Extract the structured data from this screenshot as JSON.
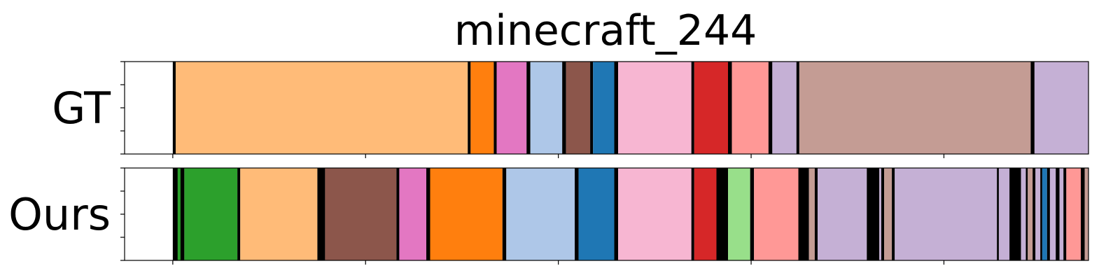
{
  "chart_data": {
    "type": "segmentation_timeline",
    "title": "minecraft_244",
    "x_range": [
      0,
      1
    ],
    "rows": [
      {
        "label": "GT",
        "segments": [
          {
            "start": 0.0,
            "end": 0.05,
            "color": "#ffffff"
          },
          {
            "start": 0.05,
            "end": 0.053,
            "color": "#000000"
          },
          {
            "start": 0.053,
            "end": 0.356,
            "color": "#ffbb78"
          },
          {
            "start": 0.356,
            "end": 0.359,
            "color": "#000000"
          },
          {
            "start": 0.359,
            "end": 0.383,
            "color": "#ff7f0e"
          },
          {
            "start": 0.383,
            "end": 0.386,
            "color": "#000000"
          },
          {
            "start": 0.386,
            "end": 0.417,
            "color": "#e377c2"
          },
          {
            "start": 0.417,
            "end": 0.421,
            "color": "#000000"
          },
          {
            "start": 0.421,
            "end": 0.454,
            "color": "#aec7e8"
          },
          {
            "start": 0.454,
            "end": 0.458,
            "color": "#000000"
          },
          {
            "start": 0.458,
            "end": 0.483,
            "color": "#8c564b"
          },
          {
            "start": 0.483,
            "end": 0.486,
            "color": "#000000"
          },
          {
            "start": 0.486,
            "end": 0.508,
            "color": "#1f77b4"
          },
          {
            "start": 0.508,
            "end": 0.512,
            "color": "#000000"
          },
          {
            "start": 0.512,
            "end": 0.588,
            "color": "#f7b6d2"
          },
          {
            "start": 0.588,
            "end": 0.591,
            "color": "#000000"
          },
          {
            "start": 0.591,
            "end": 0.626,
            "color": "#d62728"
          },
          {
            "start": 0.626,
            "end": 0.63,
            "color": "#000000"
          },
          {
            "start": 0.63,
            "end": 0.668,
            "color": "#ff9896"
          },
          {
            "start": 0.668,
            "end": 0.672,
            "color": "#000000"
          },
          {
            "start": 0.672,
            "end": 0.697,
            "color": "#c5b0d5"
          },
          {
            "start": 0.697,
            "end": 0.7,
            "color": "#000000"
          },
          {
            "start": 0.7,
            "end": 0.94,
            "color": "#c49c94"
          },
          {
            "start": 0.94,
            "end": 0.944,
            "color": "#000000"
          },
          {
            "start": 0.944,
            "end": 1.05,
            "color": "#c5b0d5"
          },
          {
            "start": 1.05,
            "end": 1.053,
            "color": "#000000"
          },
          {
            "start": 1.053,
            "end": 1.1,
            "color": "#ffffff"
          }
        ]
      },
      {
        "label": "Ours",
        "segments": [
          {
            "start": 0.0,
            "end": 0.05,
            "color": "#ffffff"
          },
          {
            "start": 0.05,
            "end": 0.062,
            "color": "#000000"
          },
          {
            "start": 0.055,
            "end": 0.058,
            "color": "#2ca02c"
          },
          {
            "start": 0.062,
            "end": 0.117,
            "color": "#2ca02c"
          },
          {
            "start": 0.117,
            "end": 0.12,
            "color": "#000000"
          },
          {
            "start": 0.12,
            "end": 0.2,
            "color": "#ffbb78"
          },
          {
            "start": 0.2,
            "end": 0.208,
            "color": "#000000"
          },
          {
            "start": 0.208,
            "end": 0.282,
            "color": "#8c564b"
          },
          {
            "start": 0.282,
            "end": 0.285,
            "color": "#000000"
          },
          {
            "start": 0.285,
            "end": 0.313,
            "color": "#e377c2"
          },
          {
            "start": 0.313,
            "end": 0.317,
            "color": "#000000"
          },
          {
            "start": 0.317,
            "end": 0.392,
            "color": "#ff7f0e"
          },
          {
            "start": 0.392,
            "end": 0.396,
            "color": "#000000"
          },
          {
            "start": 0.396,
            "end": 0.467,
            "color": "#aec7e8"
          },
          {
            "start": 0.467,
            "end": 0.471,
            "color": "#000000"
          },
          {
            "start": 0.471,
            "end": 0.508,
            "color": "#1f77b4"
          },
          {
            "start": 0.508,
            "end": 0.512,
            "color": "#000000"
          },
          {
            "start": 0.512,
            "end": 0.588,
            "color": "#f7b6d2"
          },
          {
            "start": 0.588,
            "end": 0.591,
            "color": "#000000"
          },
          {
            "start": 0.591,
            "end": 0.614,
            "color": "#d62728"
          },
          {
            "start": 0.614,
            "end": 0.626,
            "color": "#000000"
          },
          {
            "start": 0.626,
            "end": 0.649,
            "color": "#98df8a"
          },
          {
            "start": 0.649,
            "end": 0.653,
            "color": "#000000"
          },
          {
            "start": 0.653,
            "end": 0.699,
            "color": "#ff9896"
          },
          {
            "start": 0.699,
            "end": 0.71,
            "color": "#000000"
          },
          {
            "start": 0.71,
            "end": 0.716,
            "color": "#c49c94"
          },
          {
            "start": 0.716,
            "end": 0.719,
            "color": "#000000"
          },
          {
            "start": 0.719,
            "end": 0.77,
            "color": "#c5b0d5"
          },
          {
            "start": 0.77,
            "end": 0.783,
            "color": "#000000"
          },
          {
            "start": 0.783,
            "end": 0.785,
            "color": "#c5b0d5"
          },
          {
            "start": 0.785,
            "end": 0.788,
            "color": "#000000"
          },
          {
            "start": 0.788,
            "end": 0.796,
            "color": "#c49c94"
          },
          {
            "start": 0.796,
            "end": 0.799,
            "color": "#000000"
          },
          {
            "start": 0.799,
            "end": 0.905,
            "color": "#c5b0d5"
          },
          {
            "start": 0.905,
            "end": 0.907,
            "color": "#000000"
          },
          {
            "start": 0.907,
            "end": 0.918,
            "color": "#c5b0d5"
          },
          {
            "start": 0.918,
            "end": 0.93,
            "color": "#000000"
          },
          {
            "start": 0.93,
            "end": 0.935,
            "color": "#c5b0d5"
          },
          {
            "start": 0.935,
            "end": 0.937,
            "color": "#000000"
          },
          {
            "start": 0.937,
            "end": 0.942,
            "color": "#c49c94"
          },
          {
            "start": 0.942,
            "end": 0.945,
            "color": "#000000"
          },
          {
            "start": 0.945,
            "end": 0.95,
            "color": "#c5b0d5"
          },
          {
            "start": 0.95,
            "end": 0.952,
            "color": "#000000"
          },
          {
            "start": 0.952,
            "end": 0.957,
            "color": "#1f77b4"
          },
          {
            "start": 0.957,
            "end": 0.96,
            "color": "#000000"
          },
          {
            "start": 0.96,
            "end": 0.966,
            "color": "#c5b0d5"
          },
          {
            "start": 0.966,
            "end": 0.97,
            "color": "#000000"
          },
          {
            "start": 0.97,
            "end": 0.974,
            "color": "#c5b0d5"
          },
          {
            "start": 0.974,
            "end": 0.977,
            "color": "#000000"
          },
          {
            "start": 0.977,
            "end": 0.992,
            "color": "#ff9896"
          },
          {
            "start": 0.992,
            "end": 0.996,
            "color": "#000000"
          },
          {
            "start": 0.996,
            "end": 1.017,
            "color": "#c49c94"
          },
          {
            "start": 1.017,
            "end": 1.02,
            "color": "#000000"
          },
          {
            "start": 1.02,
            "end": 1.053,
            "color": "#c5b0d5"
          },
          {
            "start": 1.053,
            "end": 1.056,
            "color": "#000000"
          },
          {
            "start": 1.056,
            "end": 1.058,
            "color": "#1f77b4"
          },
          {
            "start": 1.058,
            "end": 1.061,
            "color": "#000000"
          },
          {
            "start": 1.061,
            "end": 1.1,
            "color": "#ffffff"
          }
        ]
      }
    ],
    "x_ticks": [
      0.05,
      0.25,
      0.45,
      0.65,
      0.85,
      1.05
    ],
    "y_ticks_per_row": 5,
    "grid": false,
    "legend": "none"
  }
}
